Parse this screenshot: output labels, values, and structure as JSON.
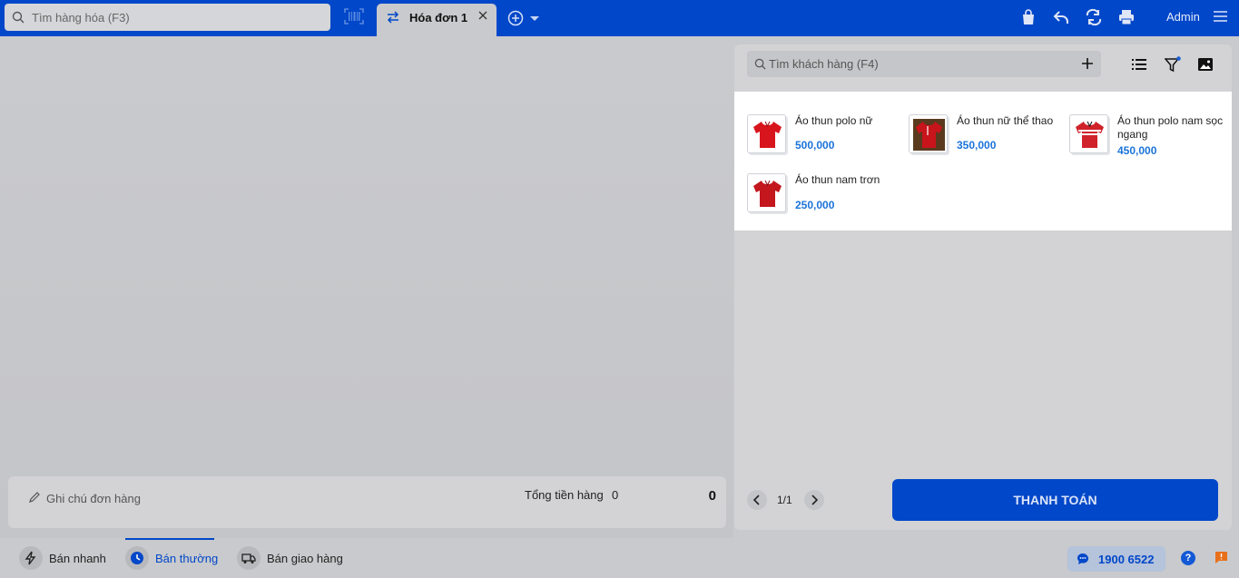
{
  "header": {
    "search_placeholder": "Tìm hàng hóa (F3)",
    "tab_label": "Hóa đơn 1",
    "user": "Admin"
  },
  "order": {
    "note_placeholder": "Ghi chú đơn hàng",
    "total_label": "Tổng tiền hàng",
    "item_count": "0",
    "total_value": "0"
  },
  "customer": {
    "search_placeholder": "Tìm khách hàng (F4)"
  },
  "products": [
    {
      "name": "Áo thun polo nữ",
      "price": "500,000"
    },
    {
      "name": "Áo thun nữ thể thao",
      "price": "350,000"
    },
    {
      "name": "Áo thun polo nam sọc ngang",
      "price": "450,000"
    },
    {
      "name": "Áo thun nam trơn",
      "price": "250,000"
    }
  ],
  "pager": {
    "text": "1/1"
  },
  "pay_button": "THANH TOÁN",
  "modes": [
    {
      "label": "Bán nhanh",
      "icon": "lightning-icon",
      "active": false
    },
    {
      "label": "Bán thường",
      "icon": "clock-icon",
      "active": true
    },
    {
      "label": "Bán giao hàng",
      "icon": "truck-icon",
      "active": false
    }
  ],
  "hotline": "1900 6522",
  "colors": {
    "brand": "#0047c9",
    "price": "#1a73d9"
  }
}
